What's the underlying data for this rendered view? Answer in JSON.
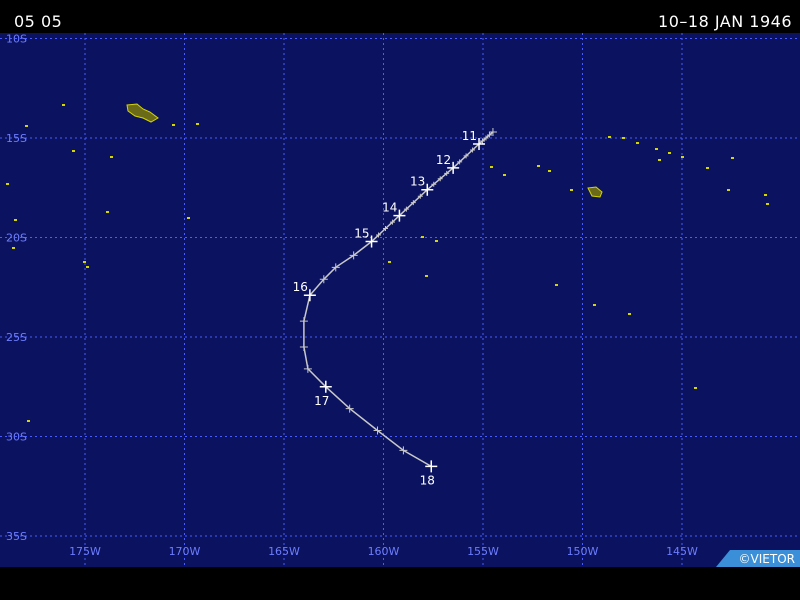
{
  "header": {
    "storm_id": "05 05",
    "date_range": "10–18 JAN 1946"
  },
  "map": {
    "background_color": "#0b1360",
    "grid_color": "#4a5cff",
    "label_color": "#6d7dff",
    "track_color": "#c8c8c8",
    "land_color": "#d6d600",
    "lon_labels": [
      "175W",
      "170W",
      "165W",
      "160W",
      "155W",
      "150W",
      "145W"
    ],
    "lat_labels": [
      "10S",
      "15S",
      "20S",
      "25S",
      "30S",
      "35S"
    ],
    "credit": "©VIETOR"
  },
  "track": {
    "points": [
      {
        "lon": -154.5,
        "lat": -14.7
      },
      {
        "lon": -155.2,
        "lat": -15.3,
        "day": "11"
      },
      {
        "lon": -156.5,
        "lat": -16.5,
        "day": "12"
      },
      {
        "lon": -157.8,
        "lat": -17.6,
        "day": "13"
      },
      {
        "lon": -159.2,
        "lat": -18.9,
        "day": "14"
      },
      {
        "lon": -160.6,
        "lat": -20.2,
        "day": "15"
      },
      {
        "lon": -161.5,
        "lat": -20.9
      },
      {
        "lon": -162.4,
        "lat": -21.5
      },
      {
        "lon": -163.0,
        "lat": -22.1
      },
      {
        "lon": -163.7,
        "lat": -22.9,
        "day": "16"
      },
      {
        "lon": -164.0,
        "lat": -24.2
      },
      {
        "lon": -164.0,
        "lat": -25.5
      },
      {
        "lon": -163.8,
        "lat": -26.6
      },
      {
        "lon": -162.9,
        "lat": -27.5,
        "day": "17"
      },
      {
        "lon": -161.7,
        "lat": -28.6
      },
      {
        "lon": -160.3,
        "lat": -29.7
      },
      {
        "lon": -159.0,
        "lat": -30.7
      },
      {
        "lon": -157.6,
        "lat": -31.5,
        "day": "18"
      }
    ]
  }
}
